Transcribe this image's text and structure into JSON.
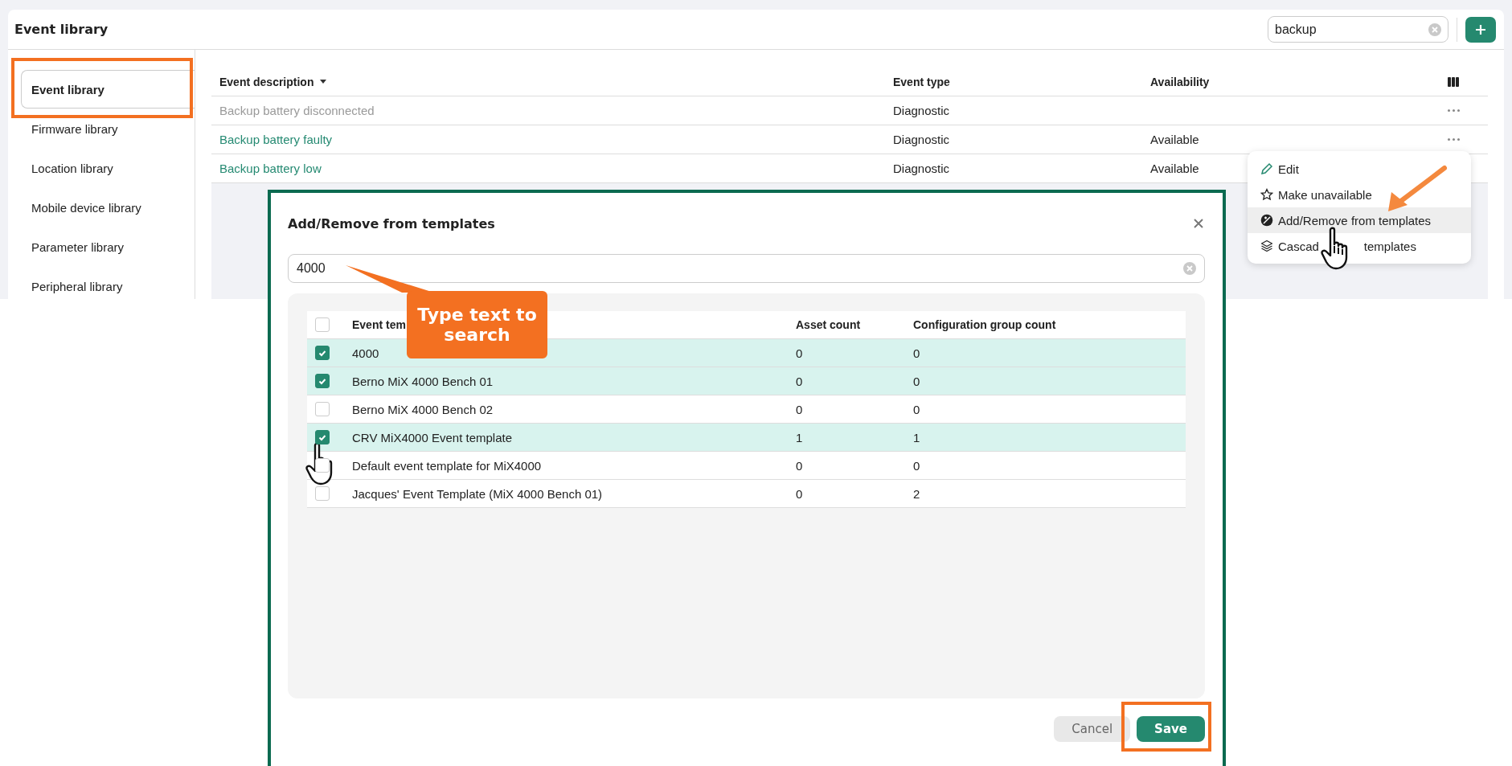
{
  "header": {
    "title": "Event library",
    "search": {
      "value": "backup"
    }
  },
  "sidebar": {
    "items": [
      {
        "label": "Event library",
        "selected": true
      },
      {
        "label": "Firmware library",
        "selected": false
      },
      {
        "label": "Location library",
        "selected": false
      },
      {
        "label": "Mobile device library",
        "selected": false
      },
      {
        "label": "Parameter library",
        "selected": false
      },
      {
        "label": "Peripheral library",
        "selected": false
      }
    ]
  },
  "table": {
    "columns": [
      "Event description",
      "Event type",
      "Availability"
    ],
    "rows": [
      {
        "description": "Backup battery disconnected",
        "type": "Diagnostic",
        "disabled": true
      },
      {
        "description": "Backup battery faulty",
        "type": "Diagnostic",
        "availability": "Available",
        "disabled": false
      },
      {
        "description": "Backup battery low",
        "type": "Diagnostic",
        "availability": "Available",
        "disabled": false
      }
    ]
  },
  "context_menu": {
    "items": [
      {
        "label": "Edit",
        "kind": "edit",
        "highlighted": false
      },
      {
        "label": "Make unavailable",
        "kind": "star",
        "highlighted": false
      },
      {
        "label": "Add/Remove from templates",
        "kind": "template",
        "highlighted": true
      },
      {
        "label": "Cascad",
        "label_tail": "templates",
        "kind": "layers",
        "highlighted": false
      }
    ]
  },
  "dialog": {
    "title": "Add/Remove from templates",
    "search": {
      "value": "4000"
    },
    "table": {
      "columns": [
        "Event tem",
        "Asset count",
        "Configuration group count"
      ],
      "all_checked": false,
      "rows": [
        {
          "name": "4000",
          "asset_count": "0",
          "group_count": "0",
          "checked": true
        },
        {
          "name": "Berno MiX 4000 Bench 01",
          "asset_count": "0",
          "group_count": "0",
          "checked": true
        },
        {
          "name": "Berno MiX 4000 Bench 02",
          "asset_count": "0",
          "group_count": "0",
          "checked": false
        },
        {
          "name": "CRV MiX4000 Event template",
          "asset_count": "1",
          "group_count": "1",
          "checked": true
        },
        {
          "name": "Default event template for MiX4000",
          "asset_count": "0",
          "group_count": "0",
          "checked": false
        },
        {
          "name": "Jacques' Event Template (MiX 4000 Bench 01)",
          "asset_count": "0",
          "group_count": "2",
          "checked": false
        }
      ]
    },
    "buttons": [
      {
        "label": "Cancel",
        "kind": "secondary"
      },
      {
        "label": "Save",
        "kind": "primary"
      }
    ]
  },
  "annotations": {
    "callout": "Type text to search"
  }
}
